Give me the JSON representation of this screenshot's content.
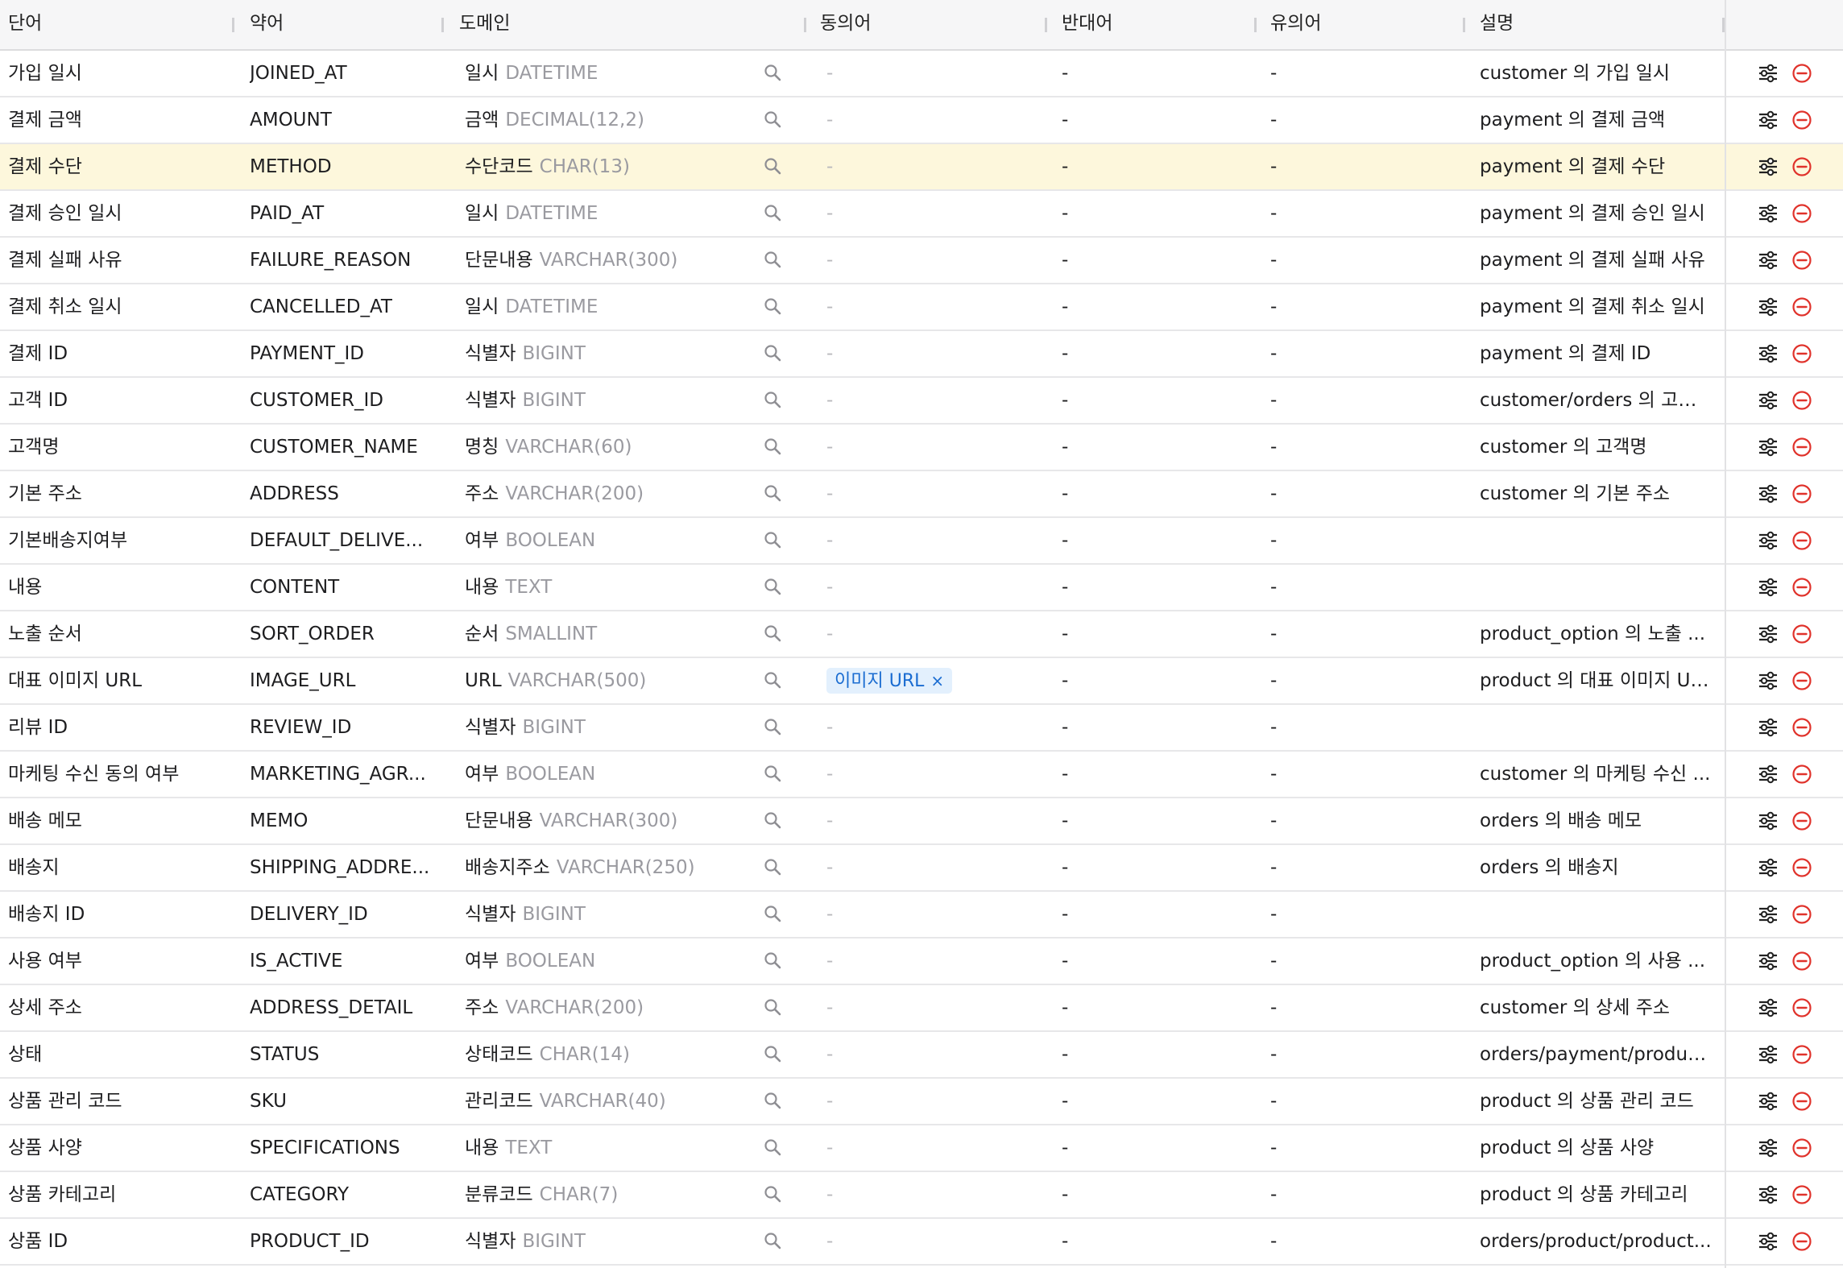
{
  "headers": {
    "word": "단어",
    "abbr": "약어",
    "domain": "도메인",
    "synonym": "동의어",
    "antonym": "반대어",
    "similar": "유의어",
    "description": "설명"
  },
  "icons": {
    "search": "search-icon",
    "settings": "tune-icon",
    "remove": "remove-circle-icon"
  },
  "colors": {
    "highlight_row": "#fdf7dc",
    "remove": "#e0322b",
    "chip_bg": "#e3f0fd",
    "chip_text": "#1a6cd1"
  },
  "rows": [
    {
      "word": "가입 일시",
      "abbr": "JOINED_AT",
      "domain_name": "일시",
      "domain_type": "DATETIME",
      "synonym": "-",
      "antonym": "-",
      "similar": "-",
      "description": "customer 의 가입 일시"
    },
    {
      "word": "결제 금액",
      "abbr": "AMOUNT",
      "domain_name": "금액",
      "domain_type": "DECIMAL(12,2)",
      "synonym": "-",
      "antonym": "-",
      "similar": "-",
      "description": "payment 의 결제 금액"
    },
    {
      "word": "결제 수단",
      "abbr": "METHOD",
      "domain_name": "수단코드",
      "domain_type": "CHAR(13)",
      "synonym": "-",
      "antonym": "-",
      "similar": "-",
      "description": "payment 의 결제 수단",
      "highlight": true
    },
    {
      "word": "결제 승인 일시",
      "abbr": "PAID_AT",
      "domain_name": "일시",
      "domain_type": "DATETIME",
      "synonym": "-",
      "antonym": "-",
      "similar": "-",
      "description": "payment 의 결제 승인 일시"
    },
    {
      "word": "결제 실패 사유",
      "abbr": "FAILURE_REASON",
      "domain_name": "단문내용",
      "domain_type": "VARCHAR(300)",
      "synonym": "-",
      "antonym": "-",
      "similar": "-",
      "description": "payment 의 결제 실패 사유"
    },
    {
      "word": "결제 취소 일시",
      "abbr": "CANCELLED_AT",
      "domain_name": "일시",
      "domain_type": "DATETIME",
      "synonym": "-",
      "antonym": "-",
      "similar": "-",
      "description": "payment 의 결제 취소 일시"
    },
    {
      "word": "결제 ID",
      "abbr": "PAYMENT_ID",
      "domain_name": "식별자",
      "domain_type": "BIGINT",
      "synonym": "-",
      "antonym": "-",
      "similar": "-",
      "description": "payment 의 결제 ID"
    },
    {
      "word": "고객 ID",
      "abbr": "CUSTOMER_ID",
      "domain_name": "식별자",
      "domain_type": "BIGINT",
      "synonym": "-",
      "antonym": "-",
      "similar": "-",
      "description": "customer/orders 의 고객 ..."
    },
    {
      "word": "고객명",
      "abbr": "CUSTOMER_NAME",
      "domain_name": "명칭",
      "domain_type": "VARCHAR(60)",
      "synonym": "-",
      "antonym": "-",
      "similar": "-",
      "description": "customer 의 고객명"
    },
    {
      "word": "기본 주소",
      "abbr": "ADDRESS",
      "domain_name": "주소",
      "domain_type": "VARCHAR(200)",
      "synonym": "-",
      "antonym": "-",
      "similar": "-",
      "description": "customer 의 기본 주소"
    },
    {
      "word": "기본배송지여부",
      "abbr": "DEFAULT_DELIVE...",
      "domain_name": "여부",
      "domain_type": "BOOLEAN",
      "synonym": "-",
      "antonym": "-",
      "similar": "-",
      "description": ""
    },
    {
      "word": "내용",
      "abbr": "CONTENT",
      "domain_name": "내용",
      "domain_type": "TEXT",
      "synonym": "-",
      "antonym": "-",
      "similar": "-",
      "description": ""
    },
    {
      "word": "노출 순서",
      "abbr": "SORT_ORDER",
      "domain_name": "순서",
      "domain_type": "SMALLINT",
      "synonym": "-",
      "antonym": "-",
      "similar": "-",
      "description": "product_option 의 노출 ..."
    },
    {
      "word": "대표 이미지 URL",
      "abbr": "IMAGE_URL",
      "domain_name": "URL",
      "domain_type": "VARCHAR(500)",
      "synonym_chip": "이미지 URL",
      "antonym": "-",
      "similar": "-",
      "description": "product 의 대표 이미지 URL"
    },
    {
      "word": "리뷰 ID",
      "abbr": "REVIEW_ID",
      "domain_name": "식별자",
      "domain_type": "BIGINT",
      "synonym": "-",
      "antonym": "-",
      "similar": "-",
      "description": ""
    },
    {
      "word": "마케팅 수신 동의 여부",
      "abbr": "MARKETING_AGR...",
      "domain_name": "여부",
      "domain_type": "BOOLEAN",
      "synonym": "-",
      "antonym": "-",
      "similar": "-",
      "description": "customer 의 마케팅 수신 ..."
    },
    {
      "word": "배송 메모",
      "abbr": "MEMO",
      "domain_name": "단문내용",
      "domain_type": "VARCHAR(300)",
      "synonym": "-",
      "antonym": "-",
      "similar": "-",
      "description": "orders 의 배송 메모"
    },
    {
      "word": "배송지",
      "abbr": "SHIPPING_ADDRE...",
      "domain_name": "배송지주소",
      "domain_type": "VARCHAR(250)",
      "synonym": "-",
      "antonym": "-",
      "similar": "-",
      "description": "orders 의 배송지"
    },
    {
      "word": "배송지 ID",
      "abbr": "DELIVERY_ID",
      "domain_name": "식별자",
      "domain_type": "BIGINT",
      "synonym": "-",
      "antonym": "-",
      "similar": "-",
      "description": ""
    },
    {
      "word": "사용 여부",
      "abbr": "IS_ACTIVE",
      "domain_name": "여부",
      "domain_type": "BOOLEAN",
      "synonym": "-",
      "antonym": "-",
      "similar": "-",
      "description": "product_option 의 사용 ..."
    },
    {
      "word": "상세 주소",
      "abbr": "ADDRESS_DETAIL",
      "domain_name": "주소",
      "domain_type": "VARCHAR(200)",
      "synonym": "-",
      "antonym": "-",
      "similar": "-",
      "description": "customer 의 상세 주소"
    },
    {
      "word": "상태",
      "abbr": "STATUS",
      "domain_name": "상태코드",
      "domain_type": "CHAR(14)",
      "synonym": "-",
      "antonym": "-",
      "similar": "-",
      "description": "orders/payment/produc..."
    },
    {
      "word": "상품 관리 코드",
      "abbr": "SKU",
      "domain_name": "관리코드",
      "domain_type": "VARCHAR(40)",
      "synonym": "-",
      "antonym": "-",
      "similar": "-",
      "description": "product 의 상품 관리 코드"
    },
    {
      "word": "상품 사양",
      "abbr": "SPECIFICATIONS",
      "domain_name": "내용",
      "domain_type": "TEXT",
      "synonym": "-",
      "antonym": "-",
      "similar": "-",
      "description": "product 의 상품 사양"
    },
    {
      "word": "상품 카테고리",
      "abbr": "CATEGORY",
      "domain_name": "분류코드",
      "domain_type": "CHAR(7)",
      "synonym": "-",
      "antonym": "-",
      "similar": "-",
      "description": "product 의 상품 카테고리"
    },
    {
      "word": "상품 ID",
      "abbr": "PRODUCT_ID",
      "domain_name": "식별자",
      "domain_type": "BIGINT",
      "synonym": "-",
      "antonym": "-",
      "similar": "-",
      "description": "orders/product/product..."
    }
  ]
}
